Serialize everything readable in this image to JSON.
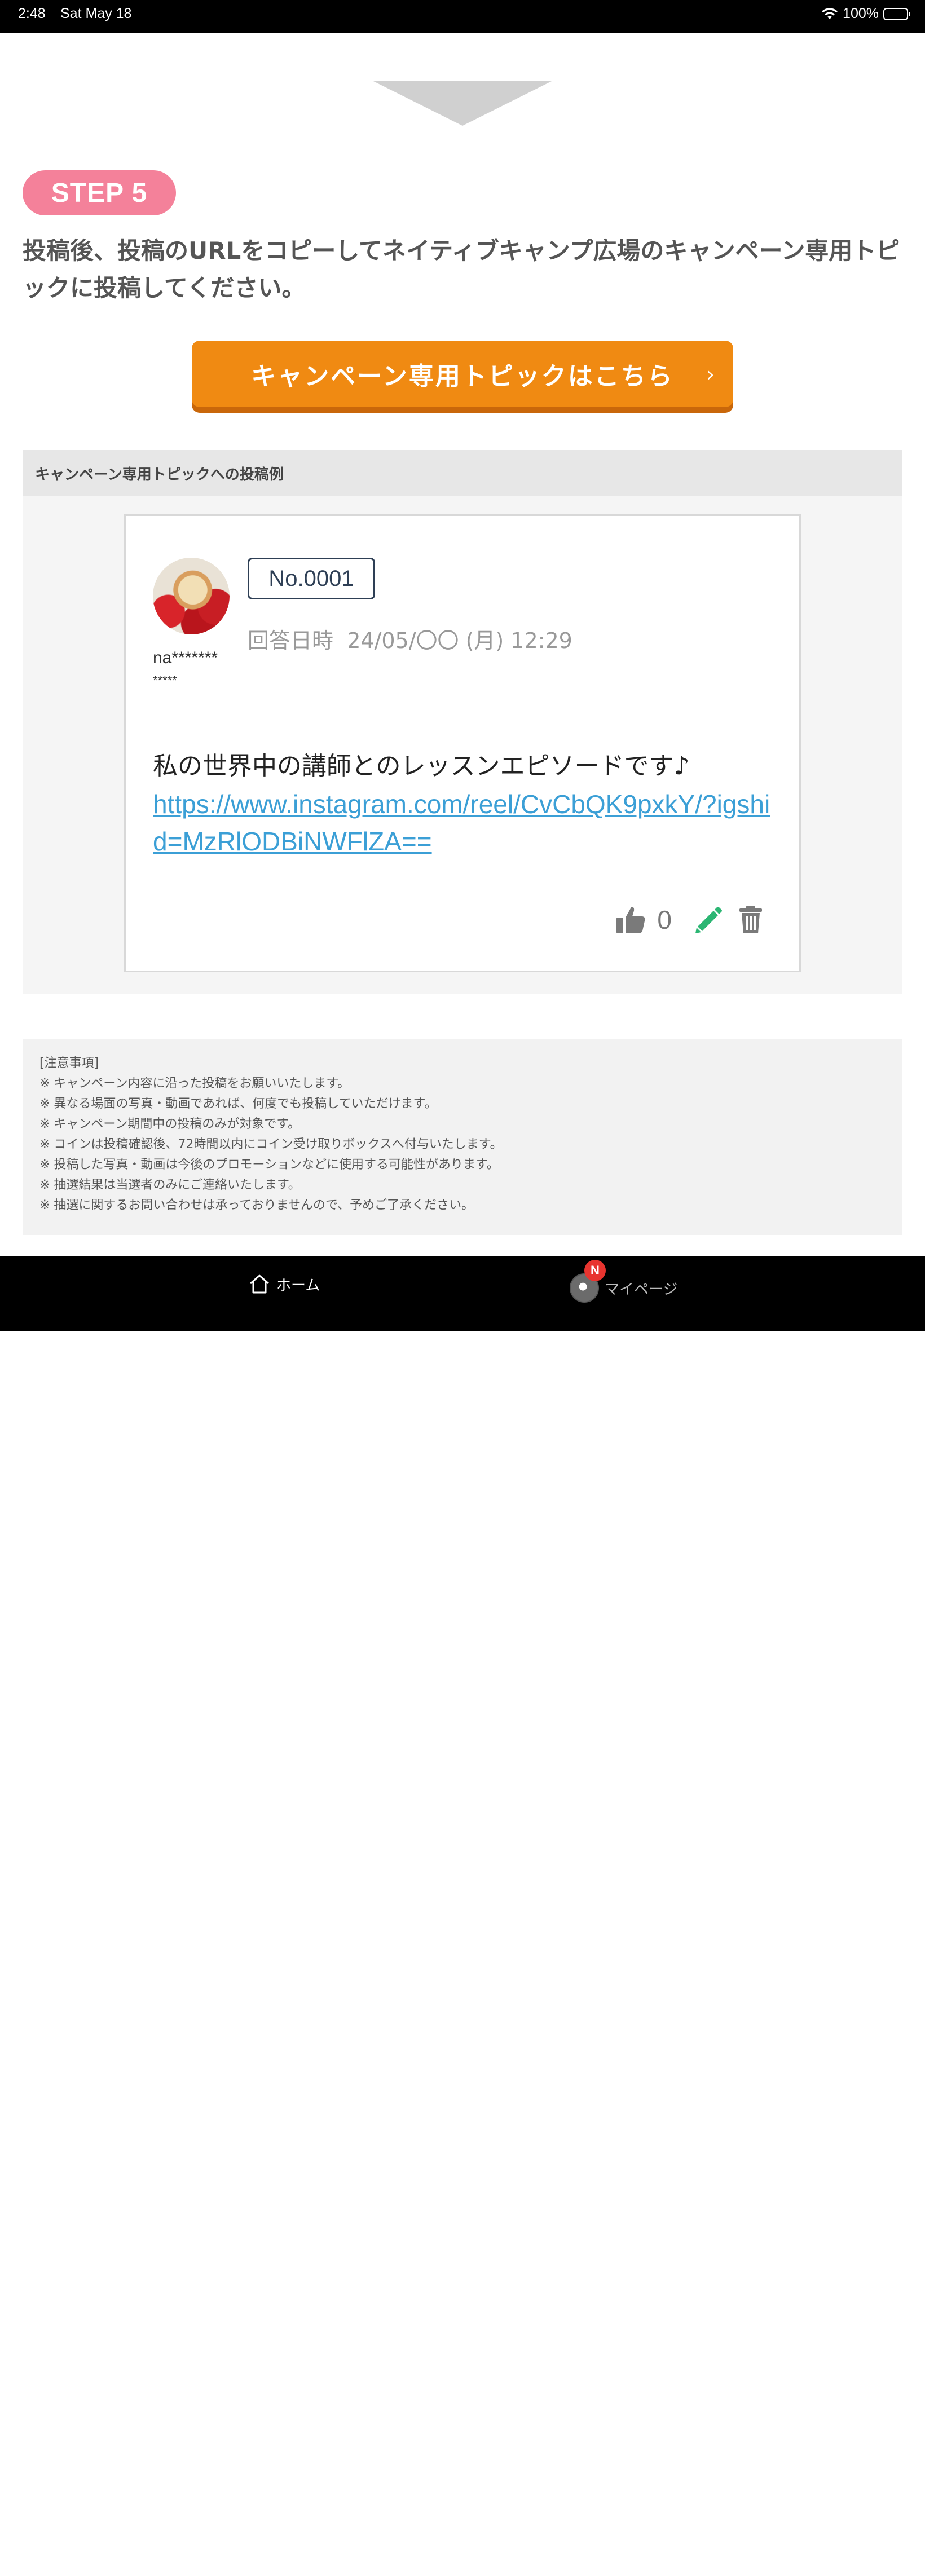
{
  "status_bar": {
    "time": "2:48",
    "date": "Sat May 18",
    "battery": "100%"
  },
  "step": {
    "label": "STEP 5",
    "instruction": "投稿後、投稿のURLをコピーしてネイティブキャンプ広場のキャンペーン専用トピックに投稿してください。"
  },
  "cta": {
    "label": "キャンペーン専用トピックはこちら",
    "chevron": "›"
  },
  "example": {
    "header": "キャンペーン専用トピックへの投稿例",
    "post": {
      "number": "No.0001",
      "answered_label": "回答日時",
      "answered_time": "24/05/〇〇 (月) 12:29",
      "username_line1": "na*******",
      "username_line2": "*****",
      "text": "私の世界中の講師とのレッスンエピソードです♪",
      "link": "https://www.instagram.com/reel/CvCbQK9pxkY/?igshid=MzRlODBiNWFlZA==",
      "like_count": "0"
    }
  },
  "notes": {
    "title": "[注意事項]",
    "items": [
      "※ キャンペーン内容に沿った投稿をお願いいたします。",
      "※ 異なる場面の写真・動画であれば、何度でも投稿していただけます。",
      "※ キャンペーン期間中の投稿のみが対象です。",
      "※ コインは投稿確認後、72時間以内にコイン受け取りボックスへ付与いたします。",
      "※ 投稿した写真・動画は今後のプロモーションなどに使用する可能性があります。",
      "※ 抽選結果は当選者のみにご連絡いたします。",
      "※ 抽選に関するお問い合わせは承っておりませんので、予めご了承ください。"
    ]
  },
  "tabbar": {
    "home": "ホーム",
    "mypage": "マイページ",
    "badge": "N"
  },
  "colors": {
    "step_pill": "#f4819a",
    "cta": "#f08a12",
    "link": "#3b9fd6",
    "edit_icon": "#2bb673"
  }
}
